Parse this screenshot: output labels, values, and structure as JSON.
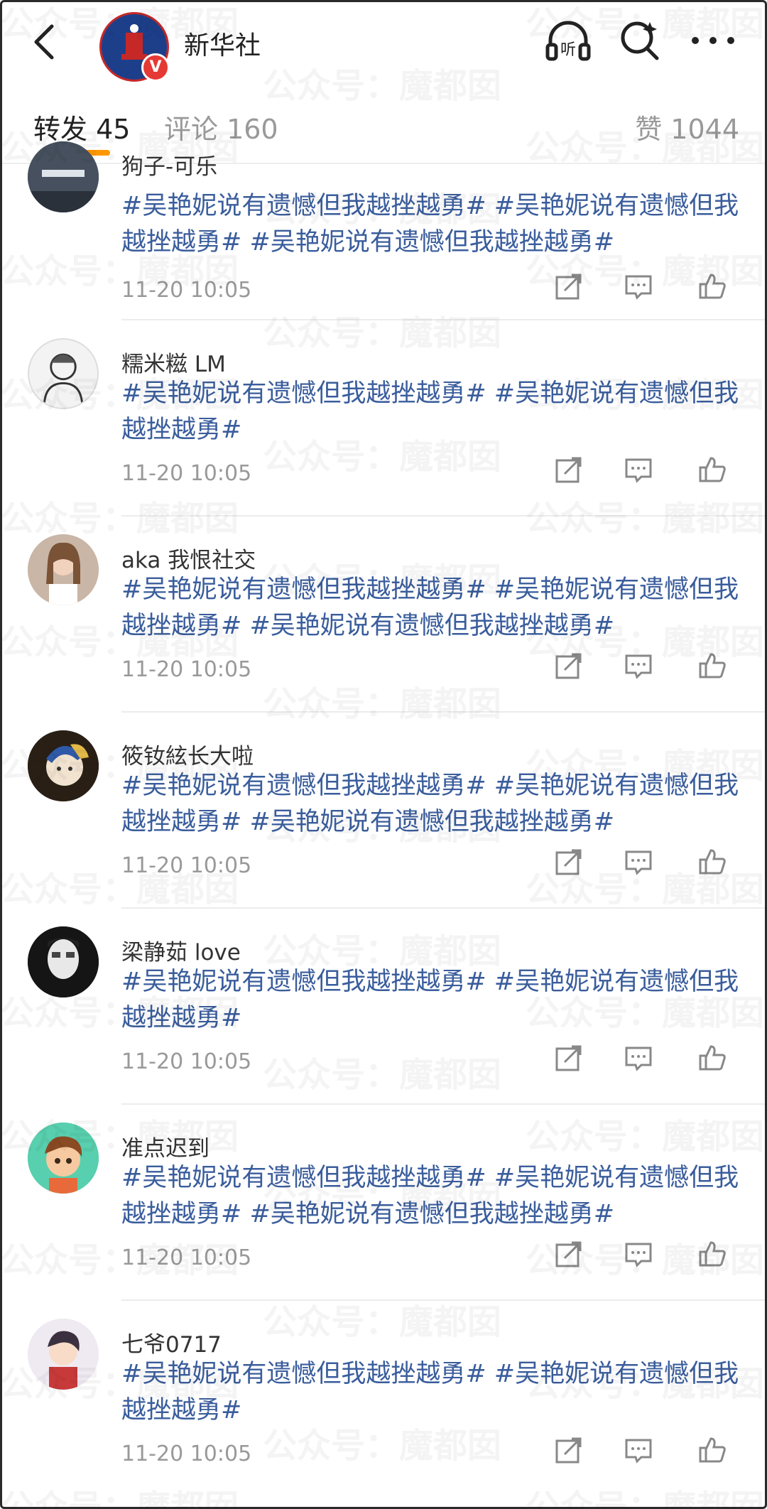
{
  "header": {
    "title": "新华社",
    "avatar_label": "新华社头像",
    "verified": "V",
    "listen_label": "听"
  },
  "tabs": {
    "repost": "转发 45",
    "comment": "评论 160",
    "likes": "赞 1044"
  },
  "watermark": "公众号：魔都囡",
  "posts": [
    {
      "name": "狗子-可乐",
      "text": "#吴艳妮说有遗憾但我越挫越勇# #吴艳妮说有遗憾但我越挫越勇# #吴艳妮说有遗憾但我越挫越勇#",
      "time": "11-20 10:05"
    },
    {
      "name": "糯米糍 LM",
      "text": "#吴艳妮说有遗憾但我越挫越勇# #吴艳妮说有遗憾但我越挫越勇#",
      "time": "11-20 10:05"
    },
    {
      "name": "aka 我恨社交",
      "text": "#吴艳妮说有遗憾但我越挫越勇# #吴艳妮说有遗憾但我越挫越勇# #吴艳妮说有遗憾但我越挫越勇#",
      "time": "11-20 10:05"
    },
    {
      "name": "筱钕絃长大啦",
      "text": "#吴艳妮说有遗憾但我越挫越勇# #吴艳妮说有遗憾但我越挫越勇# #吴艳妮说有遗憾但我越挫越勇#",
      "time": "11-20 10:05"
    },
    {
      "name": "梁静茹 love",
      "text": "#吴艳妮说有遗憾但我越挫越勇# #吴艳妮说有遗憾但我越挫越勇#",
      "time": "11-20 10:05"
    },
    {
      "name": "准点迟到",
      "text": "#吴艳妮说有遗憾但我越挫越勇# #吴艳妮说有遗憾但我越挫越勇# #吴艳妮说有遗憾但我越挫越勇#",
      "time": "11-20 10:05"
    },
    {
      "name": "七爷0717",
      "text": "#吴艳妮说有遗憾但我越挫越勇# #吴艳妮说有遗憾但我越挫越勇#",
      "time": "11-20 10:05"
    }
  ],
  "colors": {
    "accent": "#ff9800",
    "topic": "#3a5d9c",
    "meta": "#999999"
  }
}
